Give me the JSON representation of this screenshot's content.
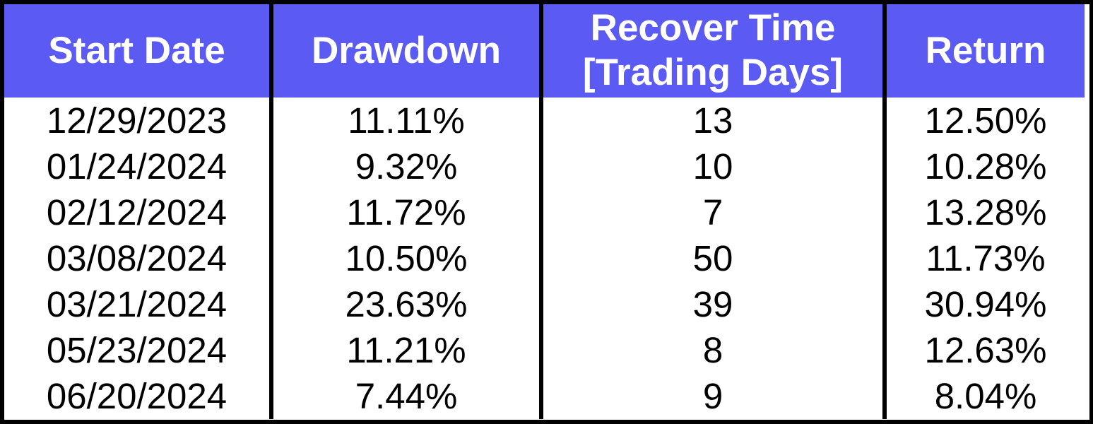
{
  "table": {
    "header_color": "#5b5bf3",
    "headers": [
      {
        "lines": [
          "Start Date"
        ]
      },
      {
        "lines": [
          "Drawdown"
        ]
      },
      {
        "lines": [
          "Recover Time",
          "[Trading Days]"
        ]
      },
      {
        "lines": [
          "Return"
        ]
      }
    ],
    "rows": [
      {
        "start_date": "12/29/2023",
        "drawdown": "11.11%",
        "recover_time": "13",
        "return": "12.50%"
      },
      {
        "start_date": "01/24/2024",
        "drawdown": "9.32%",
        "recover_time": "10",
        "return": "10.28%"
      },
      {
        "start_date": "02/12/2024",
        "drawdown": "11.72%",
        "recover_time": "7",
        "return": "13.28%"
      },
      {
        "start_date": "03/08/2024",
        "drawdown": "10.50%",
        "recover_time": "50",
        "return": "11.73%"
      },
      {
        "start_date": "03/21/2024",
        "drawdown": "23.63%",
        "recover_time": "39",
        "return": "30.94%"
      },
      {
        "start_date": "05/23/2024",
        "drawdown": "11.21%",
        "recover_time": "8",
        "return": "12.63%"
      },
      {
        "start_date": "06/20/2024",
        "drawdown": "7.44%",
        "recover_time": "9",
        "return": "8.04%"
      }
    ]
  }
}
